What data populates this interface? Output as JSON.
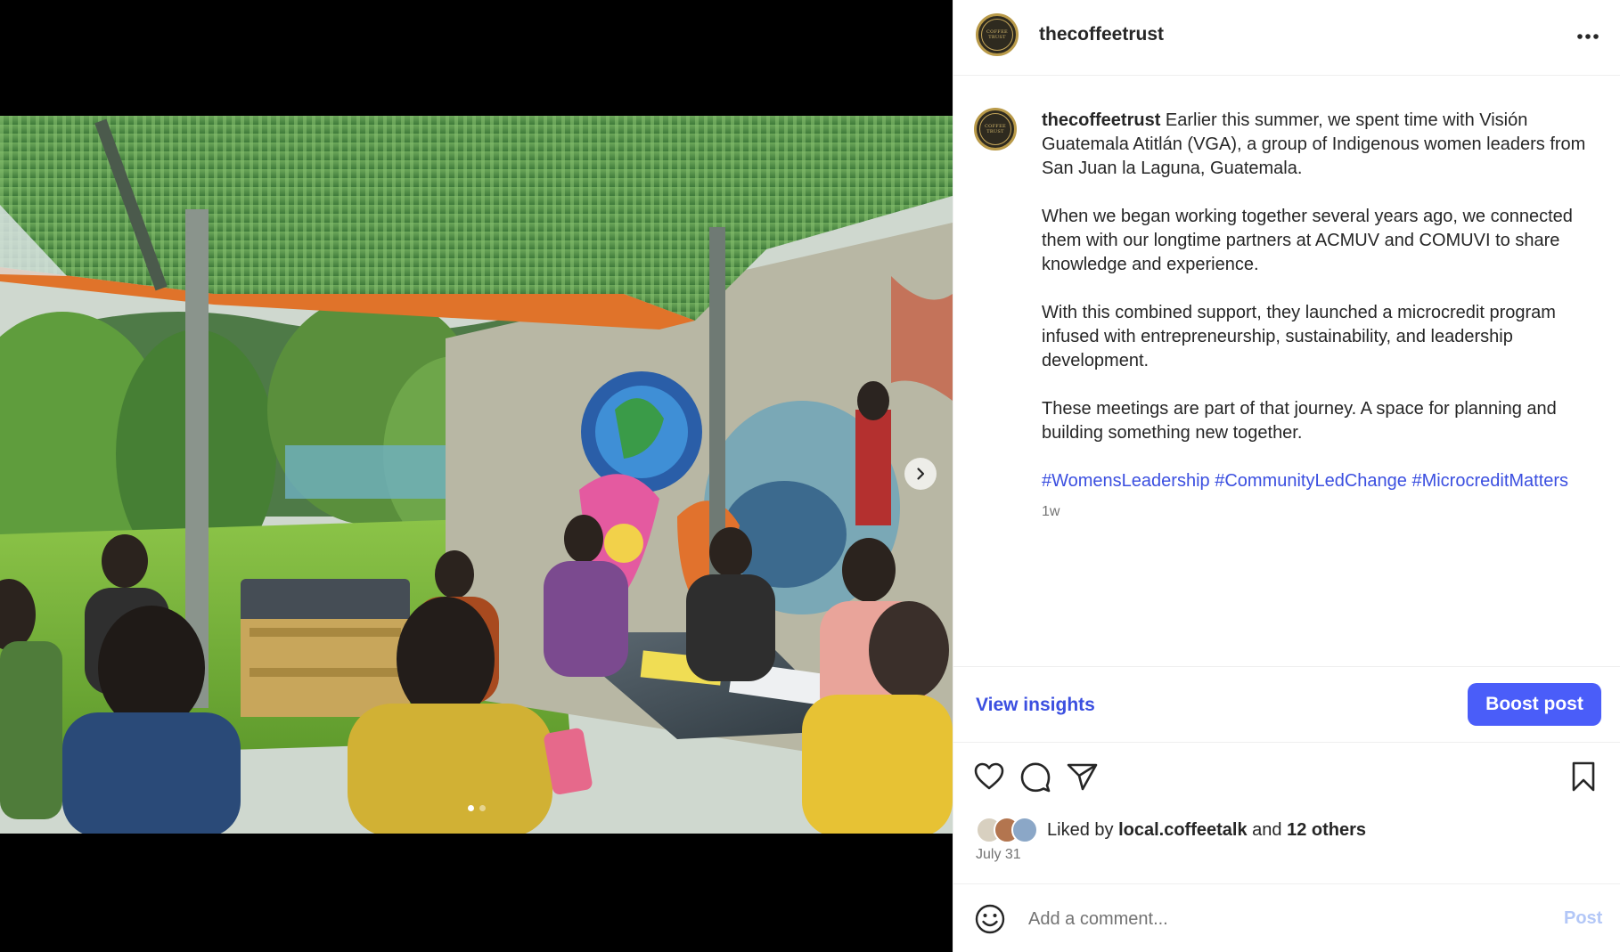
{
  "post": {
    "username": "thecoffeetrust",
    "avatar_text": [
      "COFFEE",
      "TRUST"
    ],
    "caption_paragraphs": [
      "Earlier this summer, we spent time with Visión Guatemala Atitlán (VGA), a group of Indigenous women leaders from San Juan la Laguna, Guatemala.",
      "When we began working together several years ago, we connected them with our longtime partners at ACMUV and COMUVI to share knowledge and experience.",
      "With this combined support, they launched a microcredit program infused with entrepreneurship, sustainability, and leadership development.",
      "These meetings are part of that journey. A space for planning and building something new together."
    ],
    "hashtags": [
      "#WomensLeadership",
      "#CommunityLedChange",
      "#MicrocreditMatters"
    ],
    "age": "1w",
    "media": {
      "slide_count": 2,
      "active_slide": 1
    }
  },
  "insights": {
    "view_label": "View insights",
    "boost_label": "Boost post"
  },
  "likes": {
    "prefix": "Liked by",
    "user": "local.coffeetalk",
    "middle": "and",
    "others": "12 others"
  },
  "date": "July 31",
  "comment": {
    "placeholder": "Add a comment...",
    "post_label": "Post"
  },
  "icons": {
    "more": "more-horizontal-icon",
    "like": "heart-icon",
    "comment": "comment-icon",
    "share": "send-icon",
    "save": "bookmark-icon",
    "next": "chevron-right-icon",
    "emoji": "emoji-icon"
  },
  "colors": {
    "accent": "#4a5df9",
    "link": "#3b4fe0",
    "muted": "#737373",
    "post_disabled": "#b3c7f7"
  }
}
